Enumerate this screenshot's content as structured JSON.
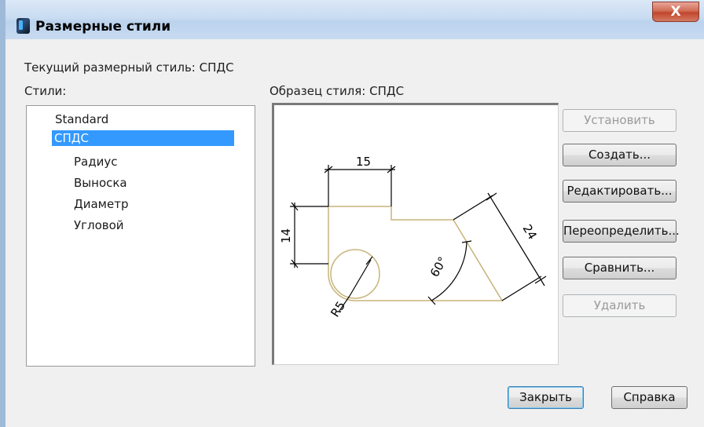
{
  "window": {
    "title": "Размерные стили",
    "close_glyph": "X"
  },
  "current_style": {
    "label": "Текущий размерный стиль: СПДС"
  },
  "styles": {
    "label": "Стили:",
    "items": [
      {
        "text": "Standard",
        "level": 0,
        "selected": false
      },
      {
        "text": "СПДС",
        "level": 0,
        "selected": true
      },
      {
        "text": "Радиус",
        "level": 1,
        "selected": false
      },
      {
        "text": "Выноска",
        "level": 1,
        "selected": false
      },
      {
        "text": "Диаметр",
        "level": 1,
        "selected": false
      },
      {
        "text": "Угловой",
        "level": 1,
        "selected": false
      }
    ]
  },
  "preview": {
    "label": "Образец стиля: СПДС",
    "dims": {
      "top": "15",
      "left": "14",
      "right": "24",
      "angle": "60°",
      "radius": "R5"
    }
  },
  "buttons": {
    "set_current": "Установить",
    "new": "Создать...",
    "modify": "Редактировать...",
    "override": "Переопределить...",
    "compare": "Сравнить...",
    "delete": "Удалить",
    "close": "Закрыть",
    "help": "Справка"
  },
  "colors": {
    "selection": "#3399ff",
    "geometry": "#c8b47a",
    "dimension": "#000000"
  }
}
